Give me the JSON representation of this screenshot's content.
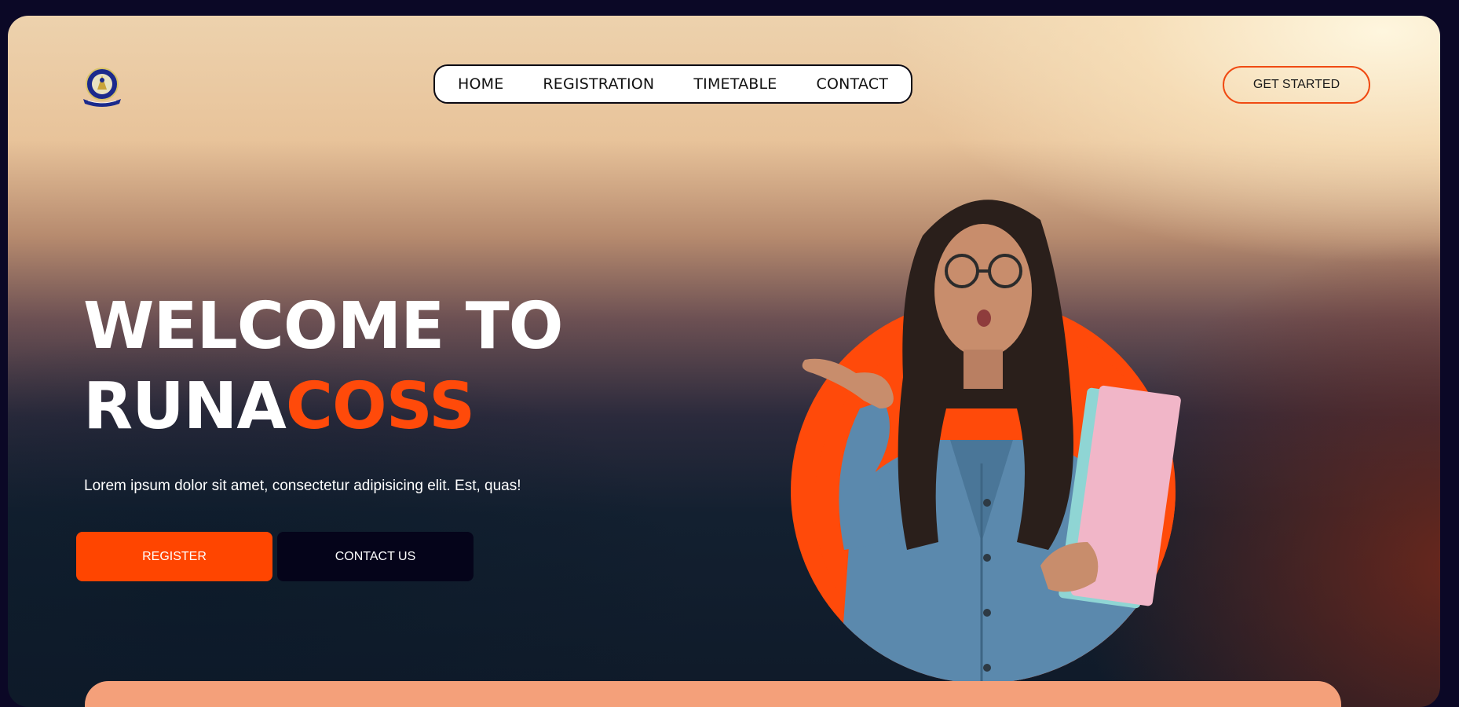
{
  "header": {
    "logo_icon": "university-crest-icon",
    "nav": [
      {
        "label": "HOME"
      },
      {
        "label": "REGISTRATION"
      },
      {
        "label": "TIMETABLE"
      },
      {
        "label": "CONTACT"
      }
    ],
    "cta_label": "GET STARTED"
  },
  "hero": {
    "title_line1": "WELCOME TO",
    "title_line2_main": "RUNA",
    "title_line2_accent": "COSS",
    "subtitle": "Lorem ipsum dolor sit amet, consectetur adipisicing elit. Est, quas!",
    "register_label": "REGISTER",
    "contact_label": "CONTACT US",
    "image_icon": "student-with-books-image"
  },
  "colors": {
    "accent": "#ff4a0a",
    "dark": "#05041a",
    "page_bg": "#0b0826"
  }
}
